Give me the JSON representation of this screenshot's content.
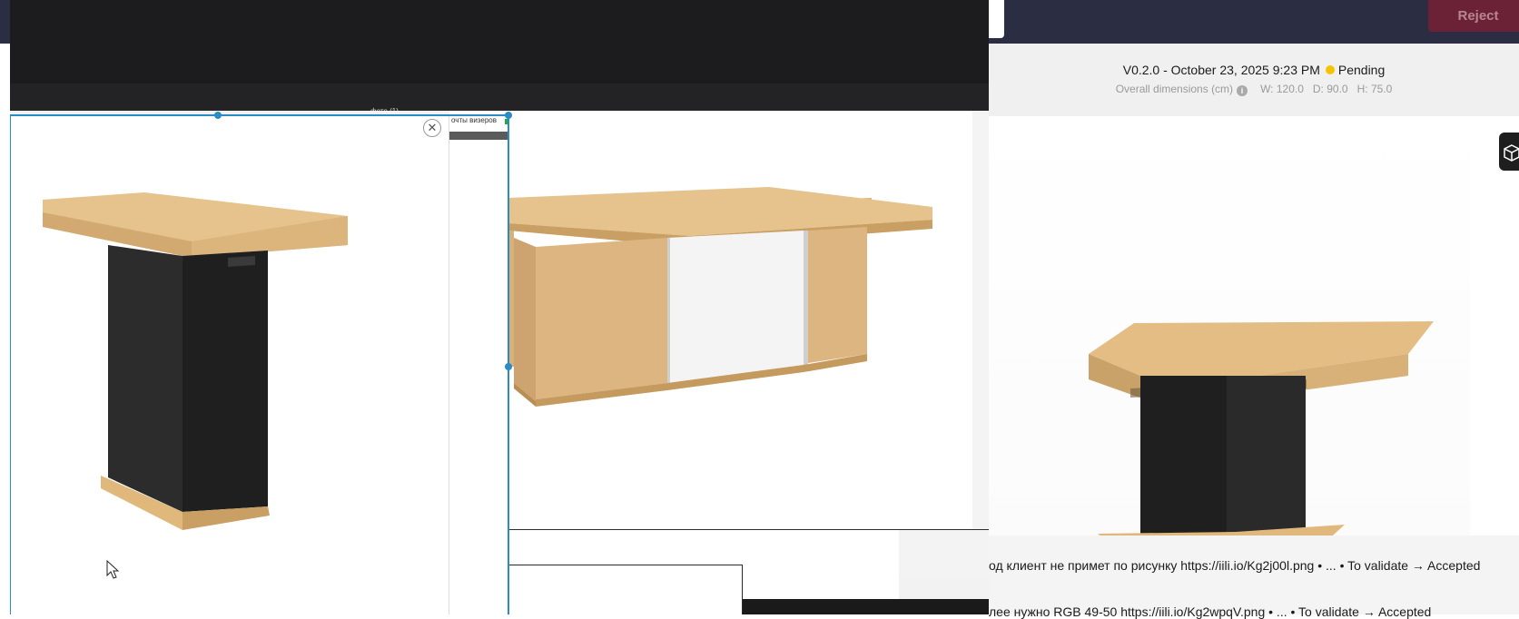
{
  "topbar": {
    "reject_label": "Reject"
  },
  "version": {
    "label": "V0.2.0 - October 23, 2025 9:23 PM",
    "status": "Pending",
    "status_color": "#f5c400"
  },
  "dimensions": {
    "label": "Overall dimensions (cm)",
    "info_icon": "info-icon",
    "w": "W: 120.0",
    "d": "D: 90.0",
    "h": "H: 75.0"
  },
  "comments": [
    {
      "text": "од клиент не примет по рисунку https://iili.io/Kg2j00l.png • ... • To validate → Accepted"
    },
    {
      "text": "лее нужно RGB 49-50 https://iili.io/Kg2wpqV.png • ... • To validate → Accepted"
    }
  ],
  "viewer": {
    "file_tab_label": "фото (1)",
    "mid_tab_label": "очты визеров",
    "close_icon": "close-icon"
  },
  "colors": {
    "accent": "#2b8bc4",
    "reject_bg": "#6b2237",
    "topbar_bg": "#2b2d42",
    "wood": "#e0b87c",
    "dark_base": "#2a2a2a"
  }
}
